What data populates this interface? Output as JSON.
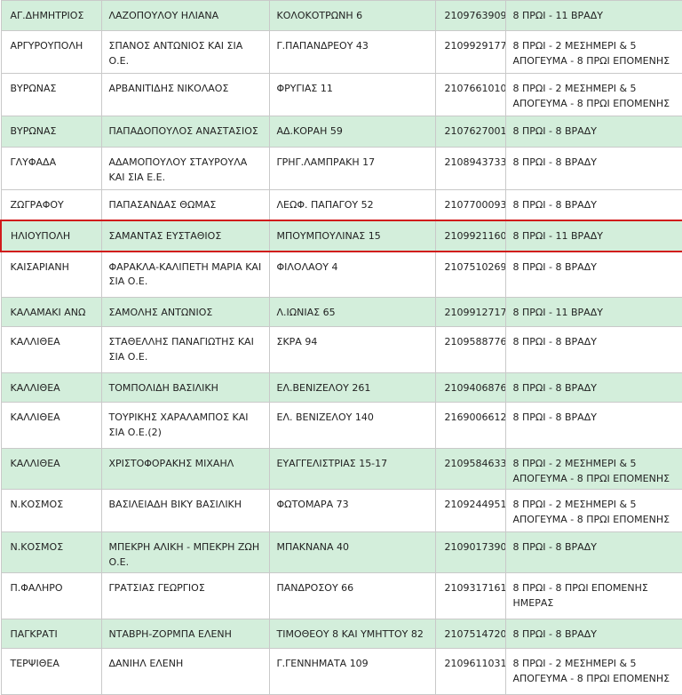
{
  "highlight_color": "#d11b1b",
  "row_colors": {
    "green": "#d3eedb",
    "white": "#ffffff"
  },
  "rows": [
    {
      "area": "ΑΓ.ΔΗΜΗΤΡΙΟΣ",
      "name": "ΛΑΖΟΠΟΥΛΟΥ ΗΛΙΑΝΑ",
      "address": "ΚΟΛΟΚΟΤΡΩΝΗ 6",
      "phone": "2109763909",
      "hours": "8 ΠΡΩΙ - 11 ΒΡΑΔΥ",
      "shade": "green",
      "highlight": false
    },
    {
      "area": "ΑΡΓΥΡΟΥΠΟΛΗ",
      "name": "ΣΠΑΝΟΣ ΑΝΤΩΝΙΟΣ ΚΑΙ ΣΙΑ Ο.Ε.",
      "address": "Γ.ΠΑΠΑΝΔΡΕΟΥ 43",
      "phone": "2109929177",
      "hours": "8 ΠΡΩΙ - 2 ΜΕΣΗΜΕΡΙ & 5 ΑΠΟΓΕΥΜΑ - 8 ΠΡΩΙ ΕΠΟΜΕΝΗΣ",
      "shade": "white",
      "highlight": false
    },
    {
      "area": "ΒΥΡΩΝΑΣ",
      "name": "ΑΡΒΑΝΙΤΙΔΗΣ ΝΙΚΟΛΑΟΣ",
      "address": "ΦΡΥΓΙΑΣ 11",
      "phone": "2107661010",
      "hours": "8 ΠΡΩΙ - 2 ΜΕΣΗΜΕΡΙ & 5 ΑΠΟΓΕΥΜΑ - 8 ΠΡΩΙ ΕΠΟΜΕΝΗΣ",
      "shade": "white",
      "highlight": false
    },
    {
      "area": "ΒΥΡΩΝΑΣ",
      "name": "ΠΑΠΑΔΟΠΟΥΛΟΣ ΑΝΑΣΤΑΣΙΟΣ",
      "address": "ΑΔ.ΚΟΡΑΗ 59",
      "phone": "2107627001",
      "hours": "8 ΠΡΩΙ - 8 ΒΡΑΔΥ",
      "shade": "green",
      "highlight": false
    },
    {
      "area": "ΓΛΥΦΑΔΑ",
      "name": "ΑΔΑΜΟΠΟΥΛΟΥ ΣΤΑΥΡΟΥΛΑ ΚΑΙ ΣΙΑ Ε.Ε.",
      "address": "ΓΡΗΓ.ΛΑΜΠΡΑΚΗ 17",
      "phone": "2108943733",
      "hours": "8 ΠΡΩΙ - 8 ΒΡΑΔΥ",
      "shade": "white",
      "highlight": false
    },
    {
      "area": "ΖΩΓΡΑΦΟΥ",
      "name": "ΠΑΠΑΣΑΝΔΑΣ ΘΩΜΑΣ",
      "address": "ΛΕΩΦ. ΠΑΠΑΓΟΥ 52",
      "phone": "2107700093",
      "hours": "8 ΠΡΩΙ - 8 ΒΡΑΔΥ",
      "shade": "white",
      "highlight": false
    },
    {
      "area": "ΗΛΙΟΥΠΟΛΗ",
      "name": "ΣΑΜΑΝΤΑΣ ΕΥΣΤΑΘΙΟΣ",
      "address": "ΜΠΟΥΜΠΟΥΛΙΝΑΣ 15",
      "phone": "2109921160",
      "hours": "8 ΠΡΩΙ - 11 ΒΡΑΔΥ",
      "shade": "green",
      "highlight": true
    },
    {
      "area": "ΚΑΙΣΑΡΙΑΝΗ",
      "name": "ΦΑΡΑΚΛΑ-ΚΑΛΙΠΕΤΗ ΜΑΡΙΑ ΚΑΙ ΣΙΑ Ο.Ε.",
      "address": "ΦΙΛΟΛΑΟΥ 4",
      "phone": "2107510269",
      "hours": "8 ΠΡΩΙ - 8 ΒΡΑΔΥ",
      "shade": "white",
      "highlight": false
    },
    {
      "area": "ΚΑΛΑΜΑΚΙ ΑΝΩ",
      "name": "ΣΑΜΟΛΗΣ ΑΝΤΩΝΙΟΣ",
      "address": "Λ.ΙΩΝΙΑΣ 65",
      "phone": "2109912717",
      "hours": "8 ΠΡΩΙ - 11 ΒΡΑΔΥ",
      "shade": "green",
      "highlight": false
    },
    {
      "area": "ΚΑΛΛΙΘΕΑ",
      "name": "ΣΤΑΘΕΛΛΗΣ ΠΑΝΑΓΙΩΤΗΣ ΚΑΙ ΣΙΑ Ο.Ε.",
      "address": "ΣΚΡΑ 94",
      "phone": "2109588776",
      "hours": "8 ΠΡΩΙ - 8 ΒΡΑΔΥ",
      "shade": "white",
      "highlight": false
    },
    {
      "area": "ΚΑΛΛΙΘΕΑ",
      "name": "ΤΟΜΠΟΛΙΔΗ ΒΑΣΙΛΙΚΗ",
      "address": "ΕΛ.ΒΕΝΙΖΕΛΟΥ 261",
      "phone": "2109406876",
      "hours": "8 ΠΡΩΙ - 8 ΒΡΑΔΥ",
      "shade": "green",
      "highlight": false
    },
    {
      "area": "ΚΑΛΛΙΘΕΑ",
      "name": "ΤΟΥΡΙΚΗΣ ΧΑΡΑΛΑΜΠΟΣ ΚΑΙ ΣΙΑ Ο.Ε.(2)",
      "address": "ΕΛ. ΒΕΝΙΖΕΛΟΥ 140",
      "phone": "2169006612",
      "hours": "8 ΠΡΩΙ - 8 ΒΡΑΔΥ",
      "shade": "white",
      "highlight": false
    },
    {
      "area": "ΚΑΛΛΙΘΕΑ",
      "name": "ΧΡΙΣΤΟΦΟΡΑΚΗΣ ΜΙΧΑΗΛ",
      "address": "ΕΥΑΓΓΕΛΙΣΤΡΙΑΣ 15-17",
      "phone": "2109584633",
      "hours": "8 ΠΡΩΙ - 2 ΜΕΣΗΜΕΡΙ & 5 ΑΠΟΓΕΥΜΑ - 8 ΠΡΩΙ ΕΠΟΜΕΝΗΣ",
      "shade": "green",
      "highlight": false
    },
    {
      "area": "Ν.ΚΟΣΜΟΣ",
      "name": "ΒΑΣΙΛΕΙΑΔΗ ΒΙΚΥ ΒΑΣΙΛΙΚΗ",
      "address": "ΦΩΤΟΜΑΡΑ 73",
      "phone": "2109244951",
      "hours": "8 ΠΡΩΙ - 2 ΜΕΣΗΜΕΡΙ & 5 ΑΠΟΓΕΥΜΑ - 8 ΠΡΩΙ ΕΠΟΜΕΝΗΣ",
      "shade": "white",
      "highlight": false
    },
    {
      "area": "Ν.ΚΟΣΜΟΣ",
      "name": "ΜΠΕΚΡΗ ΑΛΙΚΗ - ΜΠΕΚΡΗ ΖΩΗ Ο.Ε.",
      "address": "ΜΠΑΚΝΑΝΑ 40",
      "phone": "2109017390",
      "hours": "8 ΠΡΩΙ - 8 ΒΡΑΔΥ",
      "shade": "green",
      "highlight": false
    },
    {
      "area": "Π.ΦΑΛΗΡΟ",
      "name": "ΓΡΑΤΣΙΑΣ ΓΕΩΡΓΙΟΣ",
      "address": "ΠΑΝΔΡΟΣΟΥ 66",
      "phone": "2109317161",
      "hours": "8 ΠΡΩΙ - 8 ΠΡΩΙ ΕΠΟΜΕΝΗΣ ΗΜΕΡΑΣ",
      "shade": "white",
      "highlight": false
    },
    {
      "area": "ΠΑΓΚΡΑΤΙ",
      "name": "ΝΤΑΒΡΗ-ΖΟΡΜΠΑ ΕΛΕΝΗ",
      "address": "ΤΙΜΟΘΕΟΥ 8 ΚΑΙ ΥΜΗΤΤΟΥ 82",
      "phone": "2107514720",
      "hours": "8 ΠΡΩΙ - 8 ΒΡΑΔΥ",
      "shade": "green",
      "highlight": false
    },
    {
      "area": "ΤΕΡΨΙΘΕΑ",
      "name": "ΔΑΝΙΗΛ ΕΛΕΝΗ",
      "address": "Γ.ΓΕΝΝΗΜΑΤΑ 109",
      "phone": "2109611031",
      "hours": "8 ΠΡΩΙ - 2 ΜΕΣΗΜΕΡΙ & 5 ΑΠΟΓΕΥΜΑ - 8 ΠΡΩΙ ΕΠΟΜΕΝΗΣ",
      "shade": "white",
      "highlight": false
    }
  ]
}
